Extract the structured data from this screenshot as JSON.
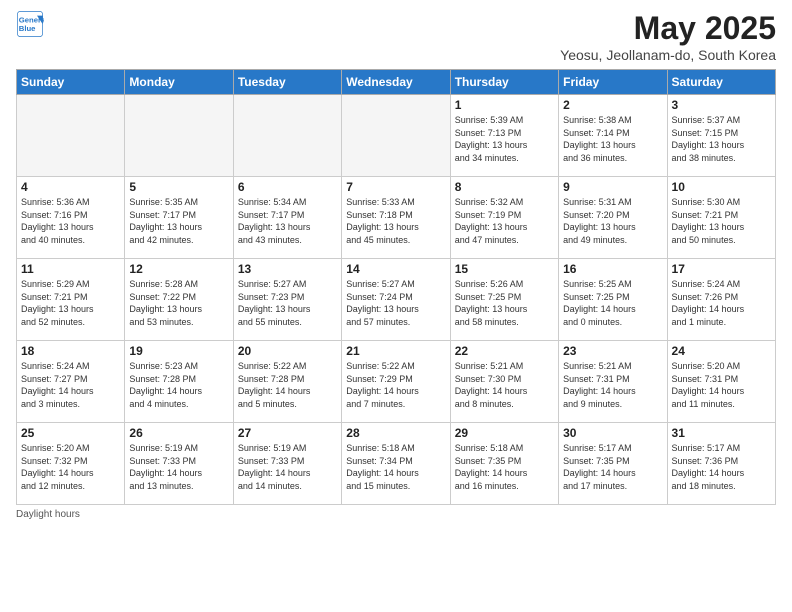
{
  "header": {
    "logo_line1": "General",
    "logo_line2": "Blue",
    "month_title": "May 2025",
    "subtitle": "Yeosu, Jeollanam-do, South Korea"
  },
  "weekdays": [
    "Sunday",
    "Monday",
    "Tuesday",
    "Wednesday",
    "Thursday",
    "Friday",
    "Saturday"
  ],
  "weeks": [
    [
      {
        "day": "",
        "info": ""
      },
      {
        "day": "",
        "info": ""
      },
      {
        "day": "",
        "info": ""
      },
      {
        "day": "",
        "info": ""
      },
      {
        "day": "1",
        "info": "Sunrise: 5:39 AM\nSunset: 7:13 PM\nDaylight: 13 hours\nand 34 minutes."
      },
      {
        "day": "2",
        "info": "Sunrise: 5:38 AM\nSunset: 7:14 PM\nDaylight: 13 hours\nand 36 minutes."
      },
      {
        "day": "3",
        "info": "Sunrise: 5:37 AM\nSunset: 7:15 PM\nDaylight: 13 hours\nand 38 minutes."
      }
    ],
    [
      {
        "day": "4",
        "info": "Sunrise: 5:36 AM\nSunset: 7:16 PM\nDaylight: 13 hours\nand 40 minutes."
      },
      {
        "day": "5",
        "info": "Sunrise: 5:35 AM\nSunset: 7:17 PM\nDaylight: 13 hours\nand 42 minutes."
      },
      {
        "day": "6",
        "info": "Sunrise: 5:34 AM\nSunset: 7:17 PM\nDaylight: 13 hours\nand 43 minutes."
      },
      {
        "day": "7",
        "info": "Sunrise: 5:33 AM\nSunset: 7:18 PM\nDaylight: 13 hours\nand 45 minutes."
      },
      {
        "day": "8",
        "info": "Sunrise: 5:32 AM\nSunset: 7:19 PM\nDaylight: 13 hours\nand 47 minutes."
      },
      {
        "day": "9",
        "info": "Sunrise: 5:31 AM\nSunset: 7:20 PM\nDaylight: 13 hours\nand 49 minutes."
      },
      {
        "day": "10",
        "info": "Sunrise: 5:30 AM\nSunset: 7:21 PM\nDaylight: 13 hours\nand 50 minutes."
      }
    ],
    [
      {
        "day": "11",
        "info": "Sunrise: 5:29 AM\nSunset: 7:21 PM\nDaylight: 13 hours\nand 52 minutes."
      },
      {
        "day": "12",
        "info": "Sunrise: 5:28 AM\nSunset: 7:22 PM\nDaylight: 13 hours\nand 53 minutes."
      },
      {
        "day": "13",
        "info": "Sunrise: 5:27 AM\nSunset: 7:23 PM\nDaylight: 13 hours\nand 55 minutes."
      },
      {
        "day": "14",
        "info": "Sunrise: 5:27 AM\nSunset: 7:24 PM\nDaylight: 13 hours\nand 57 minutes."
      },
      {
        "day": "15",
        "info": "Sunrise: 5:26 AM\nSunset: 7:25 PM\nDaylight: 13 hours\nand 58 minutes."
      },
      {
        "day": "16",
        "info": "Sunrise: 5:25 AM\nSunset: 7:25 PM\nDaylight: 14 hours\nand 0 minutes."
      },
      {
        "day": "17",
        "info": "Sunrise: 5:24 AM\nSunset: 7:26 PM\nDaylight: 14 hours\nand 1 minute."
      }
    ],
    [
      {
        "day": "18",
        "info": "Sunrise: 5:24 AM\nSunset: 7:27 PM\nDaylight: 14 hours\nand 3 minutes."
      },
      {
        "day": "19",
        "info": "Sunrise: 5:23 AM\nSunset: 7:28 PM\nDaylight: 14 hours\nand 4 minutes."
      },
      {
        "day": "20",
        "info": "Sunrise: 5:22 AM\nSunset: 7:28 PM\nDaylight: 14 hours\nand 5 minutes."
      },
      {
        "day": "21",
        "info": "Sunrise: 5:22 AM\nSunset: 7:29 PM\nDaylight: 14 hours\nand 7 minutes."
      },
      {
        "day": "22",
        "info": "Sunrise: 5:21 AM\nSunset: 7:30 PM\nDaylight: 14 hours\nand 8 minutes."
      },
      {
        "day": "23",
        "info": "Sunrise: 5:21 AM\nSunset: 7:31 PM\nDaylight: 14 hours\nand 9 minutes."
      },
      {
        "day": "24",
        "info": "Sunrise: 5:20 AM\nSunset: 7:31 PM\nDaylight: 14 hours\nand 11 minutes."
      }
    ],
    [
      {
        "day": "25",
        "info": "Sunrise: 5:20 AM\nSunset: 7:32 PM\nDaylight: 14 hours\nand 12 minutes."
      },
      {
        "day": "26",
        "info": "Sunrise: 5:19 AM\nSunset: 7:33 PM\nDaylight: 14 hours\nand 13 minutes."
      },
      {
        "day": "27",
        "info": "Sunrise: 5:19 AM\nSunset: 7:33 PM\nDaylight: 14 hours\nand 14 minutes."
      },
      {
        "day": "28",
        "info": "Sunrise: 5:18 AM\nSunset: 7:34 PM\nDaylight: 14 hours\nand 15 minutes."
      },
      {
        "day": "29",
        "info": "Sunrise: 5:18 AM\nSunset: 7:35 PM\nDaylight: 14 hours\nand 16 minutes."
      },
      {
        "day": "30",
        "info": "Sunrise: 5:17 AM\nSunset: 7:35 PM\nDaylight: 14 hours\nand 17 minutes."
      },
      {
        "day": "31",
        "info": "Sunrise: 5:17 AM\nSunset: 7:36 PM\nDaylight: 14 hours\nand 18 minutes."
      }
    ]
  ],
  "footer": {
    "label": "Daylight hours"
  }
}
